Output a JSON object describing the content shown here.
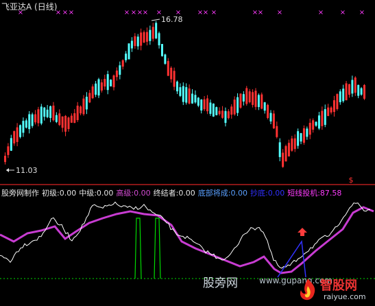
{
  "window": {
    "title": "飞亚达A (日线)"
  },
  "indicator_row": {
    "items": [
      {
        "text": "股旁网制作",
        "color": "#e6e6e6"
      },
      {
        "text": "初级:0.00",
        "color": "#e6e6e6"
      },
      {
        "text": "中级:0.00",
        "color": "#e6e6e6"
      },
      {
        "text": "高级:0.00",
        "color": "#d24bd2"
      },
      {
        "text": "终结者:0.00",
        "color": "#e6e6e6"
      },
      {
        "text": "底部将成:0.00",
        "color": "#5aa0ff"
      },
      {
        "text": "抄底:0.00",
        "color": "#3030ff"
      },
      {
        "text": "短线投机:87.58",
        "color": "#ff3cff"
      }
    ]
  },
  "watermarks": {
    "site_cn": "股旁网",
    "site_url": "www.gupang.com",
    "logo_text": "智股网",
    "logo_url": "raiyue.com"
  },
  "colors": {
    "background": "#000000",
    "up_candle": "#ff3232",
    "down_candle": "#54ffff",
    "separator": "#b41e1e",
    "marker_x": "#ff3cff",
    "white_line": "#ffffff",
    "purple_line": "#c83cd2",
    "green_signal": "#00dc00",
    "blue_spike": "#3232ff",
    "arrow": "#ff3c3c"
  },
  "chart_data": [
    {
      "type": "candlestick",
      "title": "飞亚达A (日线)",
      "annotations": [
        {
          "label": "16.78",
          "value": 16.78,
          "kind": "high"
        },
        {
          "label": "11.03",
          "value": 11.03,
          "kind": "low"
        }
      ],
      "price_range": [
        11.03,
        16.78
      ],
      "bars_count": 120,
      "top_markers": "×",
      "signal_marker": "$"
    },
    {
      "type": "line",
      "title": "",
      "series": [
        {
          "role": "white-line",
          "values": []
        },
        {
          "role": "purple-line",
          "values": []
        }
      ],
      "signals": {
        "green_pulses": 2,
        "blue_spike": 1,
        "red_arrow": 1
      }
    }
  ]
}
